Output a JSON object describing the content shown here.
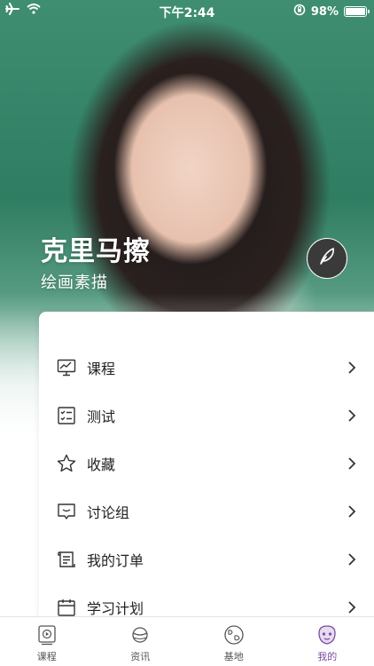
{
  "status_bar": {
    "time": "下午2:44",
    "battery": "98%",
    "battery_level": 0.98
  },
  "profile": {
    "name": "克里马擦",
    "subtitle": "绘画素描"
  },
  "menu": {
    "items": [
      {
        "label": "课程",
        "icon": "course-monitor-icon"
      },
      {
        "label": "测试",
        "icon": "test-checklist-icon"
      },
      {
        "label": "收藏",
        "icon": "star-icon"
      },
      {
        "label": "讨论组",
        "icon": "chat-bubble-icon"
      },
      {
        "label": "我的订单",
        "icon": "order-scroll-icon"
      },
      {
        "label": "学习计划",
        "icon": "calendar-icon"
      }
    ]
  },
  "tab_bar": {
    "active_color": "#7a4ca0",
    "tabs": [
      {
        "label": "课程",
        "icon": "course-tab-icon",
        "active": false
      },
      {
        "label": "资讯",
        "icon": "planet-icon",
        "active": false
      },
      {
        "label": "基地",
        "icon": "globe-icon",
        "active": false
      },
      {
        "label": "我的",
        "icon": "profile-face-icon",
        "active": true
      }
    ]
  }
}
